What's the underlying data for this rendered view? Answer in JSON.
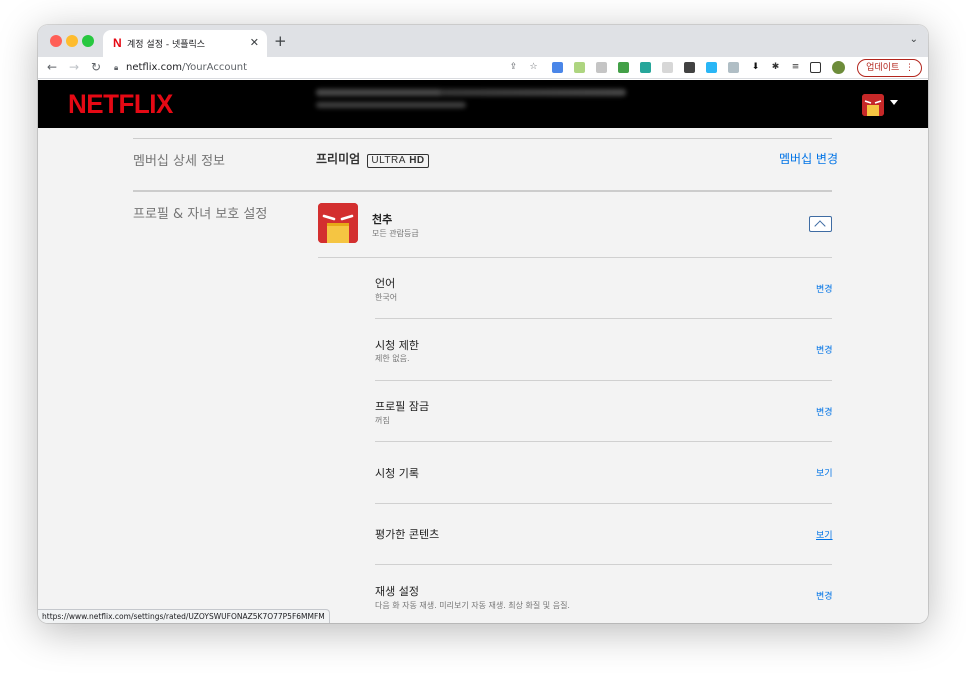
{
  "browser": {
    "tab_title": "계정 설정 - 넷플릭스",
    "tab_favicon": "N",
    "tab_close": "✕",
    "new_tab": "+",
    "url_domain": "netflix.com",
    "url_path": "/YourAccount",
    "update_button": "업데이트",
    "status_url": "https://www.netflix.com/settings/rated/UZOYSWUFONAZ5K7O77P5F6MMFM"
  },
  "header": {
    "logo": "NETFLIX"
  },
  "membership": {
    "label": "멤버십 상세 정보",
    "plan": "프리미엄",
    "badge_a": "ULTRA",
    "badge_b": "HD",
    "change_link": "멤버십 변경"
  },
  "profiles": {
    "label": "프로필 & 자녀 보호 설정",
    "profile_name": "천추",
    "profile_rating": "모든 관람등급",
    "settings": [
      {
        "title": "언어",
        "desc": "한국어",
        "action": "변경"
      },
      {
        "title": "시청 제한",
        "desc": "제한 없음.",
        "action": "변경"
      },
      {
        "title": "프로필 잠금",
        "desc": "꺼짐",
        "action": "변경"
      },
      {
        "title": "시청 기록",
        "desc": "",
        "action": "보기"
      },
      {
        "title": "평가한 콘텐츠",
        "desc": "",
        "action": "보기"
      },
      {
        "title": "재생 설정",
        "desc": "다음 화 자동 재생. 미리보기 자동 재생. 최상 화질 및 음질.",
        "action": "변경"
      }
    ]
  },
  "colors": {
    "netflix_red": "#e50914",
    "link_blue": "#0073e6",
    "page_bg": "#f3f3f3"
  }
}
